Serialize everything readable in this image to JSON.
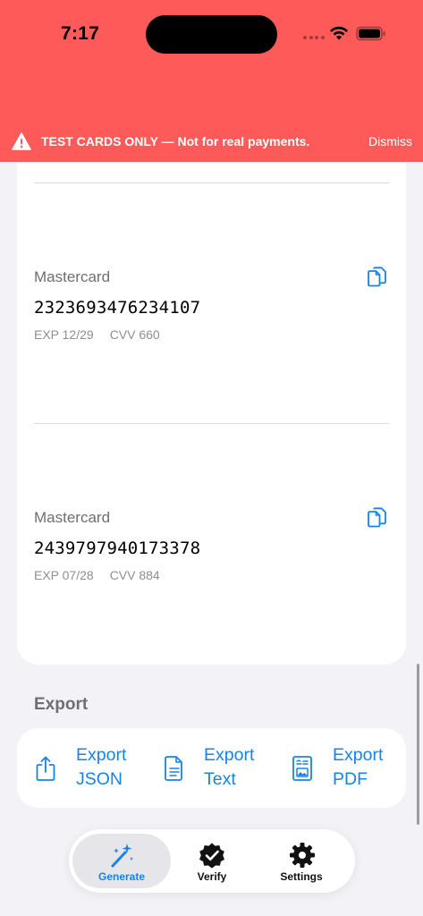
{
  "status_bar": {
    "time": "7:17"
  },
  "banner": {
    "text": "TEST CARDS ONLY — Not for real payments.",
    "dismiss_label": "Dismiss",
    "background_color": "#ff5a5a",
    "icon": "warning-triangle-icon"
  },
  "cards": [
    {
      "brand": "Mastercard",
      "number": "2323693476234107",
      "exp": "EXP 12/29",
      "cvv": "CVV 660",
      "copy_icon": "copy-documents-icon"
    },
    {
      "brand": "Mastercard",
      "number": "2439797940173378",
      "exp": "EXP 07/28",
      "cvv": "CVV 884",
      "copy_icon": "copy-documents-icon"
    }
  ],
  "export": {
    "section_title": "Export",
    "buttons": [
      {
        "line1": "Export",
        "line2": "JSON",
        "icon": "share-upload-icon"
      },
      {
        "line1": "Export",
        "line2": "Text",
        "icon": "text-document-icon"
      },
      {
        "line1": "Export",
        "line2": "PDF",
        "icon": "pdf-document-icon"
      }
    ]
  },
  "tabbar": {
    "tabs": [
      {
        "label": "Generate",
        "icon": "magic-wand-icon",
        "selected": true
      },
      {
        "label": "Verify",
        "icon": "checkmark-seal-icon",
        "selected": false
      },
      {
        "label": "Settings",
        "icon": "gear-icon",
        "selected": false
      }
    ]
  },
  "colors": {
    "accent": "#1783e6",
    "background": "#f2f2f7",
    "banner": "#ff5a5a"
  }
}
